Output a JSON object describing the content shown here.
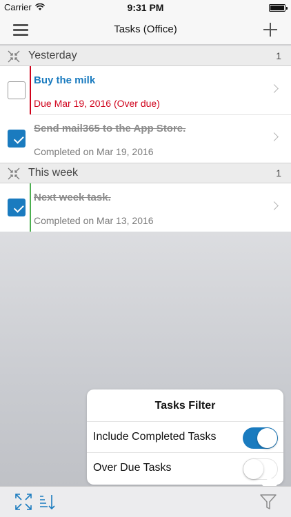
{
  "status_bar": {
    "carrier": "Carrier",
    "time": "9:31 PM"
  },
  "nav": {
    "title": "Tasks (Office)",
    "left_icon": "menu-icon",
    "right_icon": "plus-icon"
  },
  "sections": [
    {
      "label": "Yesterday",
      "count": "1",
      "tasks": [
        {
          "title": "Buy the milk",
          "subtitle": "Due Mar 19, 2016 (Over due)",
          "checked": false,
          "bar_color": "#d0021b"
        },
        {
          "title": "Send mail365 to the App Store.",
          "subtitle": "Completed on Mar 19, 2016",
          "checked": true,
          "bar_color": "#ffffff"
        }
      ]
    },
    {
      "label": "This week",
      "count": "1",
      "tasks": [
        {
          "title": "Next week task.",
          "subtitle": "Completed on Mar 13, 2016",
          "checked": true,
          "bar_color": "#4caf50"
        }
      ]
    }
  ],
  "filter": {
    "title": "Tasks Filter",
    "options": [
      {
        "label": "Include Completed Tasks",
        "enabled": true
      },
      {
        "label": "Over Due Tasks",
        "enabled": false
      }
    ]
  },
  "toolbar": {
    "icons": [
      "expand-icon",
      "sort-icon",
      "filter-icon"
    ]
  },
  "colors": {
    "accent": "#1a7bbf",
    "overdue": "#d0021b",
    "week_bar": "#4caf50"
  }
}
